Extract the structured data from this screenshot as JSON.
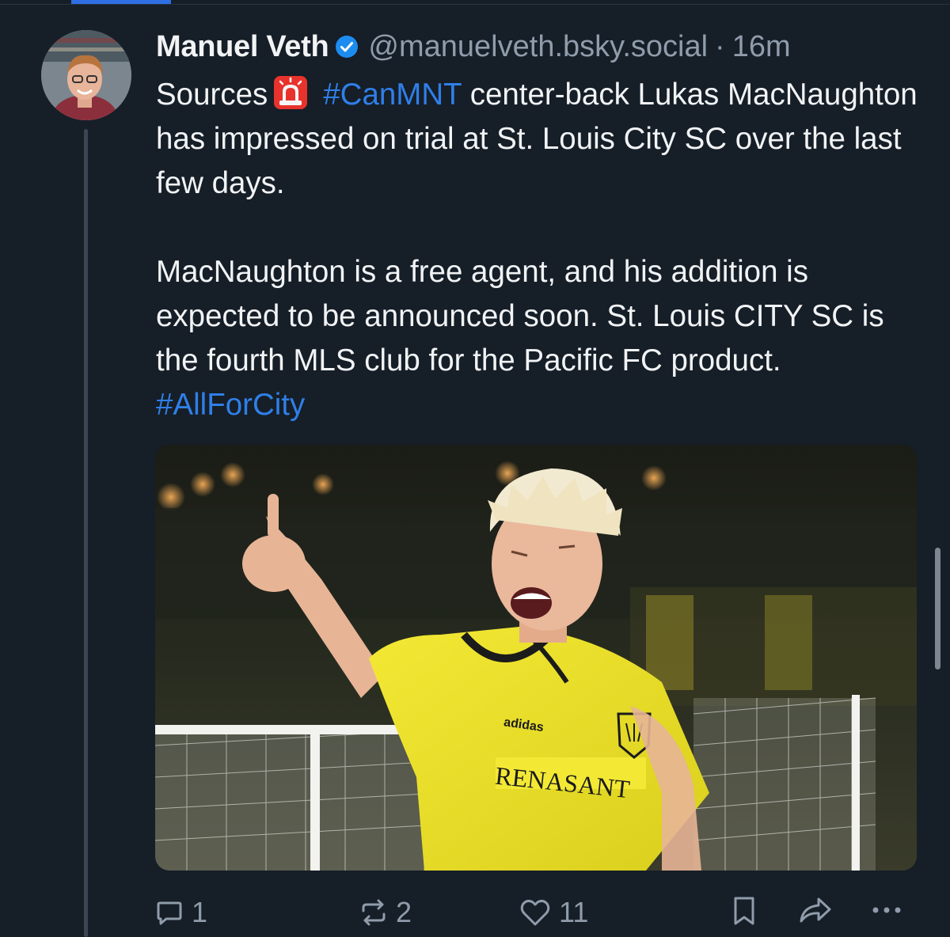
{
  "post": {
    "author": {
      "display_name": "Manuel Veth",
      "handle": "@manuelveth.bsky.social",
      "verified": true,
      "avatar_icon": "profile-photo"
    },
    "separator": "·",
    "timestamp": "16m",
    "text": {
      "p1_before": "Sources",
      "p1_emoji": "rotating-light-icon",
      "p1_hashtag": "#CanMNT",
      "p1_after": " center-back Lukas MacNaughton has impressed on trial at St. Louis City SC over the last few days.",
      "p2_text": "MacNaughton is a free agent, and his addition is expected to be announced soon. St. Louis CITY SC is the fourth MLS club for the Pacific FC product. ",
      "p2_hashtag": "#AllForCity"
    },
    "image": {
      "sponsor_text": "RENASANT",
      "kit_text": "adidas"
    },
    "actions": {
      "replies": "1",
      "reposts": "2",
      "likes": "11"
    }
  },
  "colors": {
    "background": "#161e27",
    "link": "#2f7fe8",
    "muted": "#8f9cab",
    "verified": "#1d8cf0"
  }
}
